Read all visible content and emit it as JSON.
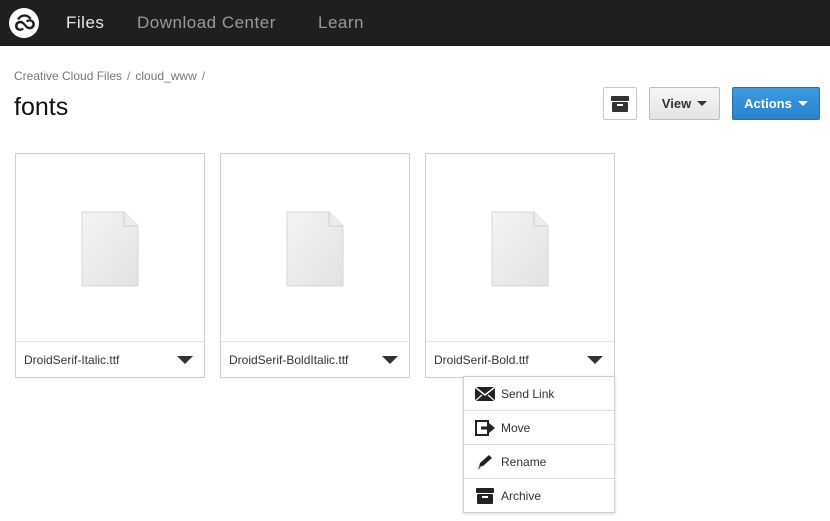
{
  "topbar": {
    "logo_icon": "creative-cloud-logo-icon",
    "nav": [
      {
        "label": "Files",
        "active": true
      },
      {
        "label": "Download Center",
        "active": false
      },
      {
        "label": "Learn",
        "active": false
      }
    ]
  },
  "breadcrumb": {
    "items": [
      "Creative Cloud Files",
      "cloud_www"
    ],
    "separator": "/"
  },
  "page": {
    "title": "fonts"
  },
  "toolbar": {
    "archive_icon": "archive-icon",
    "view_label": "View",
    "actions_label": "Actions"
  },
  "files": [
    {
      "name": "DroidSerif-Italic.ttf",
      "icon": "document-icon"
    },
    {
      "name": "DroidSerif-BoldItalic.ttf",
      "icon": "document-icon"
    },
    {
      "name": "DroidSerif-Bold.ttf",
      "icon": "document-icon"
    }
  ],
  "file_menu": {
    "items": [
      {
        "label": "Send Link",
        "icon": "envelope-icon"
      },
      {
        "label": "Move",
        "icon": "move-icon"
      },
      {
        "label": "Rename",
        "icon": "pencil-icon"
      },
      {
        "label": "Archive",
        "icon": "archive-icon"
      }
    ]
  },
  "colors": {
    "topbar_bg": "#1f1f1f",
    "nav_active": "#e8e8e8",
    "nav_inactive": "#9a9a9a",
    "accent_blue": "#2f8bd6"
  }
}
